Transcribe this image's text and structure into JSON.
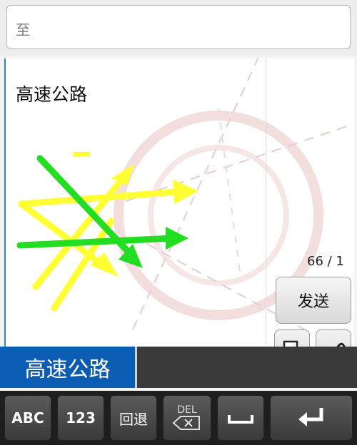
{
  "recipient": {
    "value": "至"
  },
  "message": {
    "text": "高速公路"
  },
  "counter": "66 / 1",
  "send_button": {
    "label": "发送"
  },
  "candidate": {
    "text": "高速公路"
  },
  "keyboard": {
    "abc": "ABC",
    "num": "123",
    "back": "回退",
    "del": "DEL"
  },
  "colors": {
    "accent": "#0b5db3",
    "stroke_yellow": "#ffff33",
    "stroke_green": "#22dd22"
  },
  "icons": [
    "template-icon",
    "attachment-icon",
    "backspace-icon",
    "space-icon",
    "enter-icon"
  ]
}
